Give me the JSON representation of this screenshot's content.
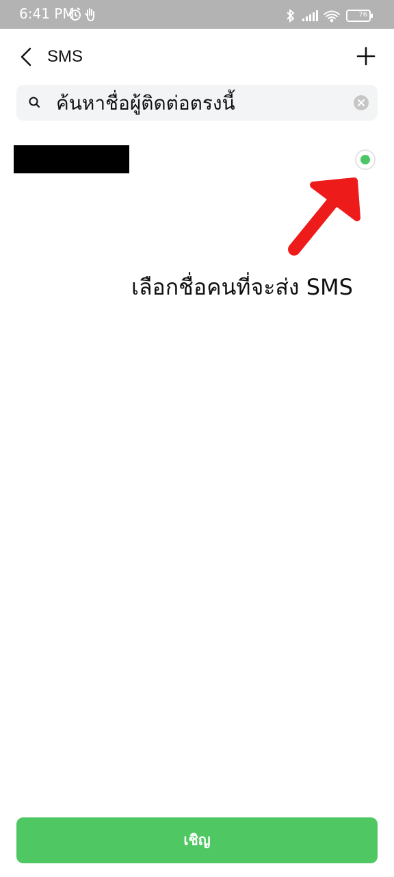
{
  "status_bar": {
    "time": "6:41 PM",
    "left_icons": [
      "alarm-icon",
      "hand-icon"
    ],
    "right_icons": [
      "bluetooth-icon",
      "signal-icon",
      "wifi-icon",
      "battery-icon"
    ],
    "battery_level": "76"
  },
  "header": {
    "title": "SMS",
    "back_icon": "chevron-left-icon",
    "add_icon": "plus-icon"
  },
  "search": {
    "placeholder": "ค้นหาชื่อผู้ติดต่อตรงนี้",
    "value": "",
    "search_icon": "search-icon",
    "clear_icon": "clear-circle-icon"
  },
  "contacts": [
    {
      "name": "",
      "selected": true
    }
  ],
  "annotation": {
    "text": "เลือกชื่อคนที่จะส่ง SMS",
    "arrow_color": "#ee1b1b"
  },
  "footer": {
    "invite_label": "เชิญ"
  },
  "colors": {
    "accent": "#4fc864",
    "status_bar": "#b3b3b3",
    "search_bg": "#f3f4f5",
    "text": "#111111"
  }
}
